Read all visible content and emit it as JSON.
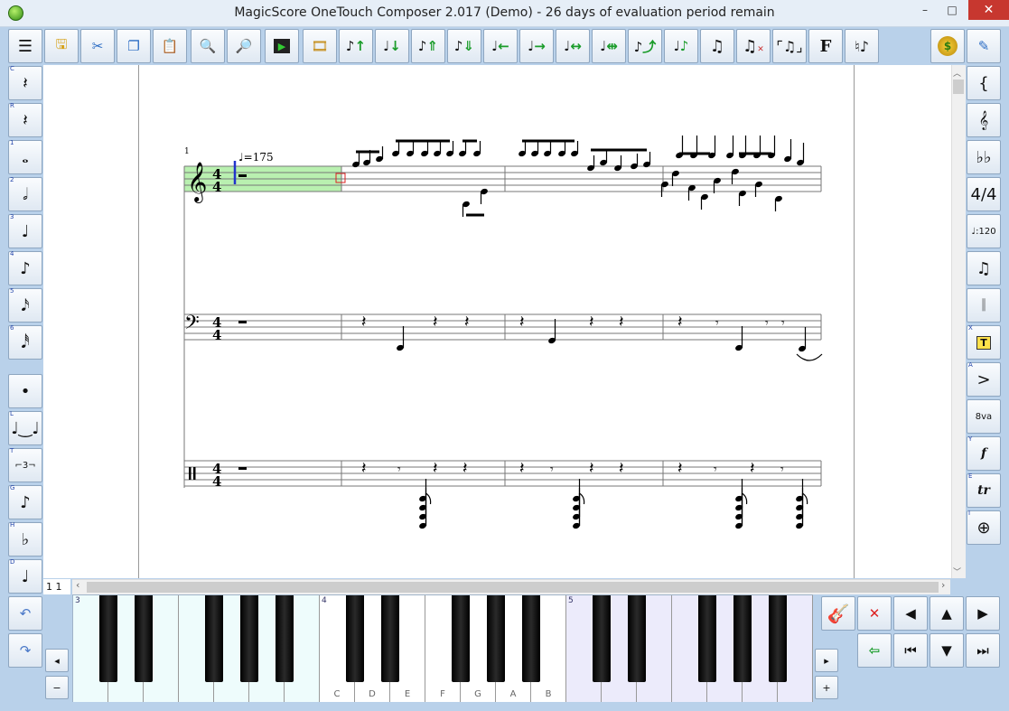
{
  "window": {
    "title": "MagicScore OneTouch Composer 2.017 (Demo) - 26 days of evaluation period remain",
    "minimize": "–",
    "maximize": "□",
    "close": "✕"
  },
  "score": {
    "measure_number": "1",
    "tempo": "♩=175",
    "time_signature_top": "4",
    "time_signature_bottom": "4"
  },
  "left_palette": [
    {
      "key": "C",
      "icon": "clef-rest-icon"
    },
    {
      "key": "R",
      "icon": "quarter-rest-icon"
    },
    {
      "key": "1",
      "icon": "whole-note-icon"
    },
    {
      "key": "2",
      "icon": "half-note-icon"
    },
    {
      "key": "3",
      "icon": "quarter-note-icon"
    },
    {
      "key": "4",
      "icon": "eighth-note-icon"
    },
    {
      "key": "5",
      "icon": "sixteenth-note-icon"
    },
    {
      "key": "6",
      "icon": "thirtysecond-note-icon"
    },
    {
      "key": "",
      "icon": "dot-icon"
    },
    {
      "key": "L",
      "icon": "tie-icon"
    },
    {
      "key": "T",
      "icon": "triplet-icon",
      "label": "⌐3¬"
    },
    {
      "key": "G",
      "icon": "grace-note-icon"
    },
    {
      "key": "H",
      "icon": "flat-icon"
    },
    {
      "key": "D",
      "icon": "delete-note-icon"
    }
  ],
  "right_palette": [
    {
      "key": "",
      "icon": "brace-icon"
    },
    {
      "key": "",
      "icon": "treble-clef-icon"
    },
    {
      "key": "",
      "icon": "key-signature-icon"
    },
    {
      "key": "",
      "icon": "time-signature-icon"
    },
    {
      "key": "",
      "icon": "tempo-icon",
      "label": "♩:120"
    },
    {
      "key": "",
      "icon": "tuplet-icon"
    },
    {
      "key": "",
      "icon": "barline-icon"
    },
    {
      "key": "X",
      "icon": "text-icon",
      "label": "T"
    },
    {
      "key": "A",
      "icon": "accent-icon",
      "label": ">"
    },
    {
      "key": "",
      "icon": "octave-icon",
      "label": "8va"
    },
    {
      "key": "Y",
      "icon": "dynamics-icon",
      "label": "f"
    },
    {
      "key": "E",
      "icon": "trill-icon",
      "label": "tr"
    },
    {
      "key": "I",
      "icon": "coda-icon",
      "label": "⊕"
    }
  ],
  "piano": {
    "octaves": [
      "3",
      "4",
      "5"
    ],
    "white_labels_oct4": [
      "C",
      "D",
      "E",
      "F",
      "G",
      "A",
      "B"
    ],
    "position": "1  1"
  },
  "bottom_right": {
    "cancel": "✕",
    "enter": "⇦"
  },
  "colors": {
    "accent": "#1a9c2a",
    "selection": "#b9f0b0",
    "titlebar": "#e6eef7",
    "close": "#c7372f"
  }
}
